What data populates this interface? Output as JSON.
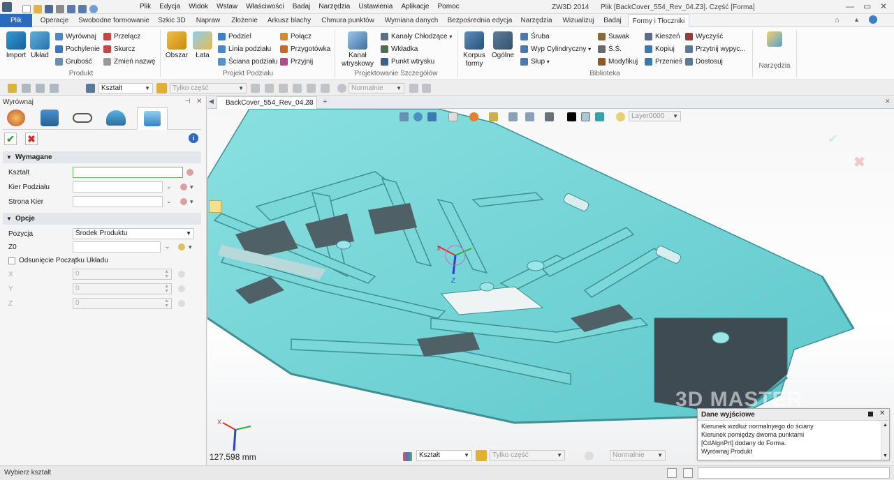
{
  "titlebar": {
    "menu": [
      "Plik",
      "Edycja",
      "Widok",
      "Wstaw",
      "Właściwości",
      "Badaj",
      "Narzędzia",
      "Ustawienia",
      "Aplikacje",
      "Pomoc"
    ],
    "app_version": "ZW3D 2014",
    "file_title": "Plik [BackCover_554_Rev_04.Z3]. Część [Forma]"
  },
  "ribbon_tabs": [
    "Plik",
    "Operacje",
    "Swobodne formowanie",
    "Szkic 3D",
    "Napraw",
    "Złożenie",
    "Arkusz blachy",
    "Chmura punktów",
    "Wymiana danych",
    "Bezpośrednia edycja",
    "Narzędzia",
    "Wizualizuj",
    "Badaj",
    "Formy i Tłoczniki"
  ],
  "ribbon": {
    "produkt": {
      "label": "Produkt",
      "import": "Import",
      "uklad": "Układ",
      "items": [
        "Wyrównaj",
        "Pochylenie",
        "Grubość",
        "Przełącz",
        "Skurcz",
        "Zmień nazwę"
      ]
    },
    "projekt_podzialu": {
      "label": "Projekt Podziału",
      "obszar": "Obszar",
      "lata": "Łata",
      "items": [
        "Podziel",
        "Linia podziału",
        "Ściana podziału",
        "Połącz",
        "Przygotówka",
        "Przyjnij"
      ]
    },
    "projektowanie": {
      "label": "Projektowanie Szczegółów",
      "kanal_line1": "Kanał",
      "kanal_line2": "wtryskowy",
      "items": [
        "Kanały Chłodzące",
        "Wkładka",
        "Punkt wtrysku"
      ]
    },
    "biblioteka": {
      "label": "Biblioteka",
      "korpus_line1": "Korpus",
      "korpus_line2": "formy",
      "ogolne": "Ogólne",
      "items": [
        "Śruba",
        "Wyp Cylindryczny",
        "Słup",
        "Suwak",
        "Ś.Ś.",
        "Modyfikuj",
        "Kieszeń",
        "Kopiuj",
        "Przenieś",
        "Wyczyść",
        "Przytnij wypyc...",
        "Dostosuj"
      ]
    },
    "narzedzia": {
      "label": "Narzędzia"
    }
  },
  "toolbar2": {
    "filter_value": "Kształt",
    "part_filter": "Tylko część",
    "render_mode": "Normalnie"
  },
  "left_panel": {
    "title": "Wyrównaj",
    "section_required": "Wymagane",
    "ksztalt_label": "Kształt",
    "kier_podzialu_label": "Kier Podziału",
    "strona_kier_label": "Strona Kier",
    "section_options": "Opcje",
    "pozycja_label": "Pozycja",
    "pozycja_value": "Środek Produktu",
    "z0_label": "Z0",
    "odsuniecie_label": "Odsunięcie Początku Układu",
    "x_label": "X",
    "y_label": "Y",
    "z_label": "Z",
    "x_value": "0",
    "y_value": "0",
    "z_value": "0"
  },
  "doc_tab": "BackCover_554_Rev_04.Z3",
  "viewport": {
    "layer": "Layer0000",
    "scale_readout": "127.598 mm",
    "filter_value": "Kształt",
    "part_filter": "Tylko część",
    "render_mode": "Normalnie",
    "watermark": "3D MASTER"
  },
  "output_panel": {
    "title": "Dane wyjściowe",
    "lines": [
      "Kierunek wzdłuż normalnyego do ściany",
      "Kierunek pomiędzy dwoma punktami",
      "[CdAlgnPrt] dodany do Forma.",
      "Wyrównaj Produkt"
    ]
  },
  "status": {
    "prompt": "Wybierz kształt"
  },
  "colors": {
    "model": "#7fd9d9",
    "accent": "#2a6bbf",
    "ok": "#3a9a3a",
    "cancel": "#d23030"
  }
}
